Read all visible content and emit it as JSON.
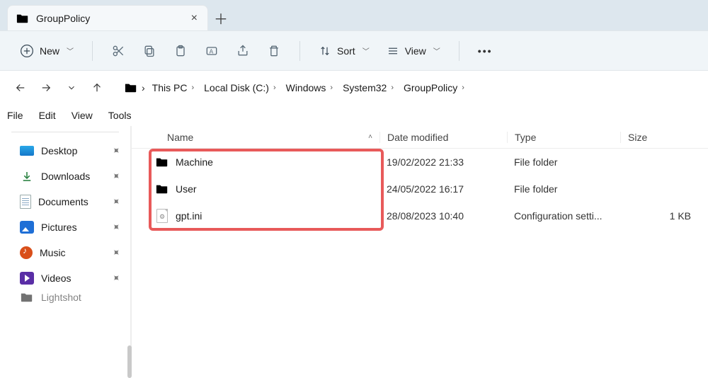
{
  "tab": {
    "title": "GroupPolicy"
  },
  "toolbar": {
    "new_label": "New",
    "sort_label": "Sort",
    "view_label": "View"
  },
  "breadcrumbs": [
    {
      "label": "This PC"
    },
    {
      "label": "Local Disk (C:)"
    },
    {
      "label": "Windows"
    },
    {
      "label": "System32"
    },
    {
      "label": "GroupPolicy"
    }
  ],
  "menu": {
    "file": "File",
    "edit": "Edit",
    "view": "View",
    "tools": "Tools"
  },
  "sidebar": {
    "items": [
      {
        "label": "Desktop"
      },
      {
        "label": "Downloads"
      },
      {
        "label": "Documents"
      },
      {
        "label": "Pictures"
      },
      {
        "label": "Music"
      },
      {
        "label": "Videos"
      },
      {
        "label": "Lightshot"
      }
    ]
  },
  "columns": {
    "name": "Name",
    "date": "Date modified",
    "type": "Type",
    "size": "Size"
  },
  "files": [
    {
      "name": "Machine",
      "date": "19/02/2022 21:33",
      "type": "File folder",
      "size": "",
      "kind": "folder"
    },
    {
      "name": "User",
      "date": "24/05/2022 16:17",
      "type": "File folder",
      "size": "",
      "kind": "folder"
    },
    {
      "name": "gpt.ini",
      "date": "28/08/2023 10:40",
      "type": "Configuration setti...",
      "size": "1 KB",
      "kind": "ini"
    }
  ]
}
